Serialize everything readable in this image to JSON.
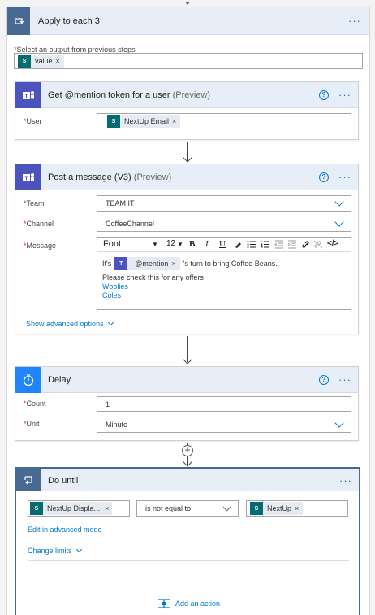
{
  "apply_each": {
    "title": "Apply to each 3",
    "output_label": "Select an output from previous steps",
    "required_mark": "*",
    "token": "value",
    "token_remove": "×"
  },
  "get_mention": {
    "title": "Get @mention token for a user",
    "preview": "(Preview)",
    "user_label": "User",
    "user_token": "NextUp Email",
    "token_remove": "×"
  },
  "post_message": {
    "title": "Post a message (V3)",
    "preview": "(Preview)",
    "team_label": "Team",
    "team_value": "TEAM IT",
    "channel_label": "Channel",
    "channel_value": "CoffeeChannel",
    "message_label": "Message",
    "toolbar": {
      "font": "Font",
      "size": "12",
      "bold": "B",
      "italic": "I",
      "underline": "U"
    },
    "message": {
      "prefix": "It's",
      "mention_token": "@mention",
      "token_remove": "×",
      "suffix": "'s turn to bring Coffee Beans.",
      "line2": "Please check this for any offers",
      "link1": "Woolies",
      "link2": "Coles"
    },
    "advanced_link": "Show advanced options"
  },
  "delay": {
    "title": "Delay",
    "count_label": "Count",
    "count_value": "1",
    "unit_label": "Unit",
    "unit_value": "Minute"
  },
  "do_until": {
    "title": "Do until",
    "left_token": "NextUp Displa...",
    "left_remove": "×",
    "operator": "is not equal to",
    "right_token": "NextUp",
    "right_remove": "×",
    "edit_advanced": "Edit in advanced mode",
    "change_limits": "Change limits",
    "add_action": "Add an action"
  },
  "ui": {
    "more_dots": "···",
    "help_glyph": "?",
    "plus_glyph": "+"
  },
  "colors": {
    "teams": "#4b53bc",
    "loop": "#486991",
    "delay": "#1f85ff",
    "accent": "#0078d4",
    "sharepoint_token": "#036c70",
    "required": "#d13438"
  }
}
